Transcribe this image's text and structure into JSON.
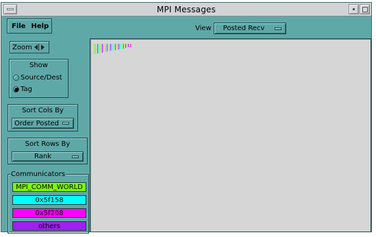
{
  "window": {
    "title": "MPI Messages"
  },
  "menubar": {
    "file": "File",
    "help": "Help"
  },
  "view": {
    "label": "View",
    "selected": "Posted Recv"
  },
  "zoom": {
    "label": "Zoom"
  },
  "show": {
    "title": "Show",
    "options": [
      {
        "label": "Source/Dest",
        "selected": false
      },
      {
        "label": "Tag",
        "selected": true
      }
    ]
  },
  "sort_cols": {
    "title": "Sort Cols By",
    "selected": "Order Posted"
  },
  "sort_rows": {
    "title": "Sort Rows By",
    "selected": "Rank"
  },
  "communicators": {
    "title": "Communicators",
    "items": [
      {
        "label": "MPI_COMM_WORLD",
        "color": "#7cfc00"
      },
      {
        "label": "0x5f158",
        "color": "#00ffff"
      },
      {
        "label": "0x5f208",
        "color": "#ff00ff"
      },
      {
        "label": "others",
        "color": "#a020f0"
      }
    ]
  },
  "colors": {
    "window_bg": "#5fa8a8",
    "canvas_bg": "#d6d6d6",
    "titlebar_bg": "#d3d3d3"
  },
  "message_ticks": [
    {
      "color": "#7cfc00"
    },
    {
      "color": "#7cfc00"
    },
    {
      "color": "#ff00ff"
    },
    {
      "color": "#00ffff"
    },
    {
      "color": "#7cfc00"
    },
    {
      "color": "#a020f0"
    },
    {
      "color": "#7cfc00"
    },
    {
      "color": "#00ffff"
    },
    {
      "color": "#ff00ff"
    },
    {
      "color": "#7cfc00"
    },
    {
      "color": "#a020f0"
    },
    {
      "color": "#00ffff"
    },
    {
      "color": "#7cfc00"
    },
    {
      "color": "#ff00ff"
    },
    {
      "color": "#7cfc00"
    },
    {
      "color": "#a020f0"
    },
    {
      "color": "#00ffff"
    },
    {
      "color": "#7cfc00"
    },
    {
      "color": "#ff00ff"
    },
    {
      "color": "#a020f0"
    },
    {
      "color": "#7cfc00"
    },
    {
      "color": "#a020f0"
    },
    {
      "color": "#ff00ff"
    },
    {
      "color": "#7cfc00"
    }
  ]
}
